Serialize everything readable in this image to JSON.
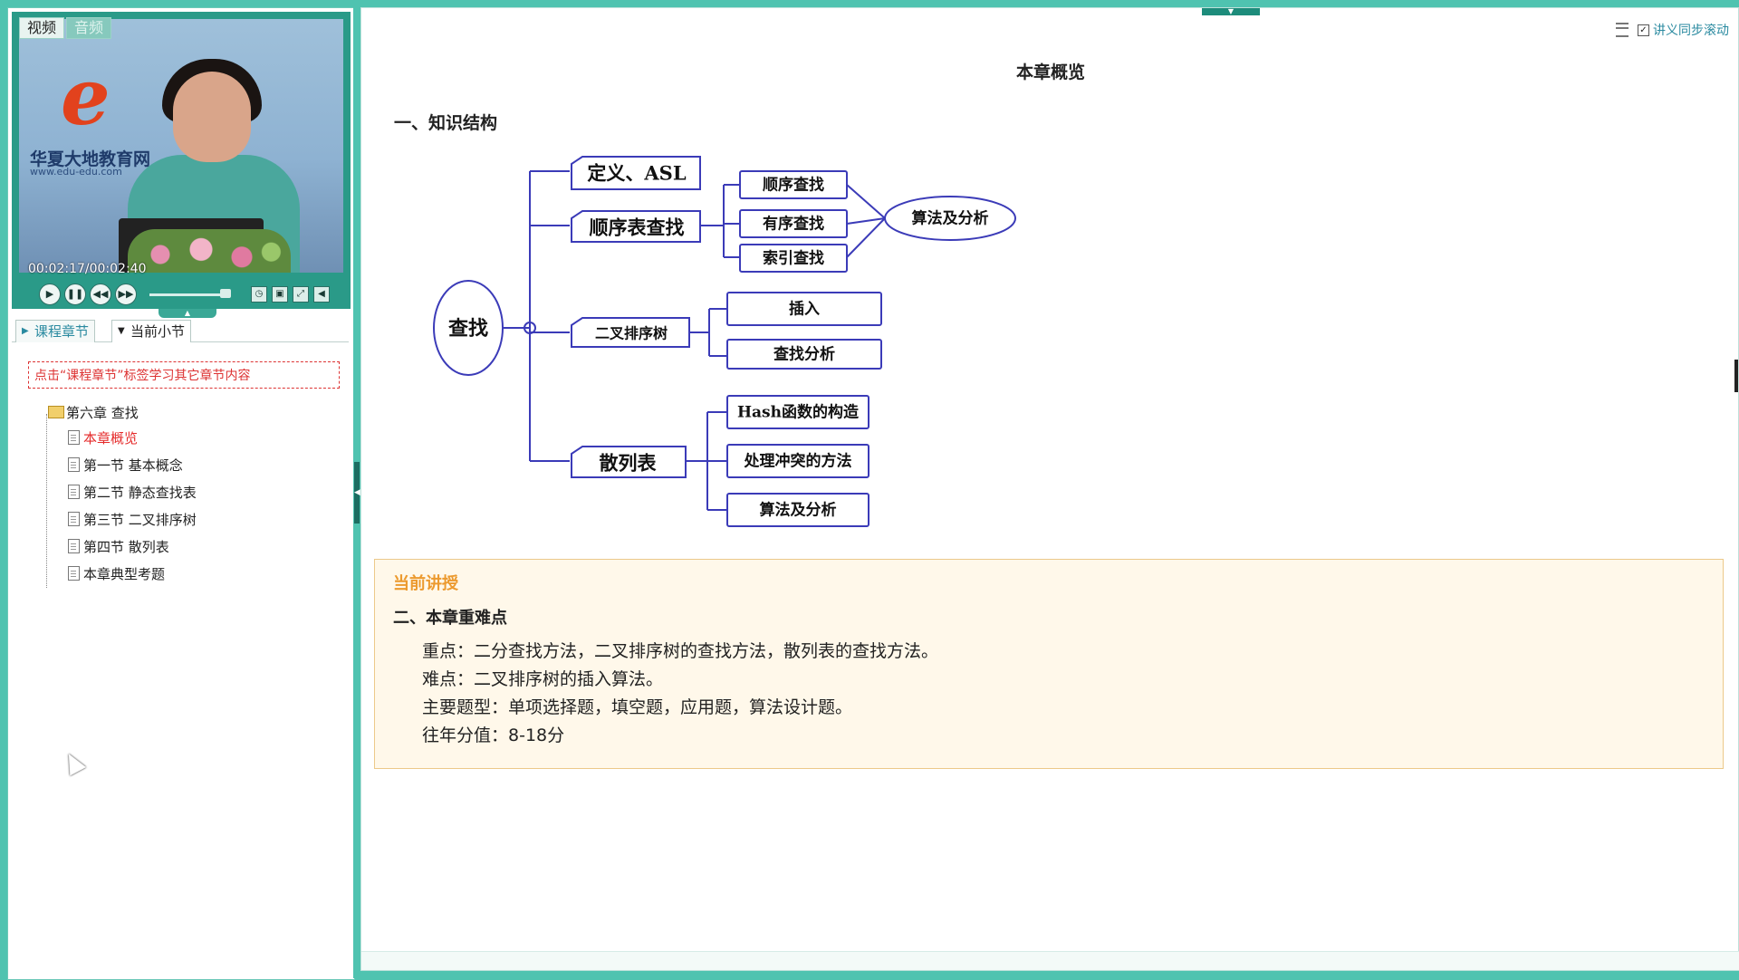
{
  "media_tabs": {
    "video": "视频",
    "audio": "音频"
  },
  "player": {
    "logo_text": "华夏大地教育网",
    "logo_url": "www.edu-edu.com",
    "time": "00:02:17/00:02:40"
  },
  "nav_tabs": {
    "chapters": "课程章节",
    "current_section": "当前小节"
  },
  "hint": "点击“课程章节”标签学习其它章节内容",
  "tree": {
    "chapter": "第六章 查找",
    "items": [
      {
        "label": "本章概览",
        "active": true
      },
      {
        "label": "第一节 基本概念",
        "active": false
      },
      {
        "label": "第二节 静态查找表",
        "active": false
      },
      {
        "label": "第三节 二叉排序树",
        "active": false
      },
      {
        "label": "第四节 散列表",
        "active": false
      },
      {
        "label": "本章典型考题",
        "active": false
      }
    ]
  },
  "toolbar": {
    "sync_label": "讲义同步滚动",
    "sync_checked": true
  },
  "content": {
    "title": "本章概览",
    "section1": "一、知识结构",
    "mindmap": {
      "root": "查找",
      "def": "定义、ASL",
      "seq_table": "顺序表查找",
      "seq_children": [
        "顺序查找",
        "有序查找",
        "索引查找"
      ],
      "algo": "算法及分析",
      "bst": "二叉排序树",
      "bst_children": [
        "插入",
        "查找分析"
      ],
      "hash": "散列表",
      "hash_children": [
        "Hash函数的构造",
        "处理冲突的方法",
        "算法及分析"
      ]
    },
    "current_label": "当前讲授",
    "section2": "二、本章重难点",
    "lines": [
      "重点：二分查找方法，二叉排序树的查找方法，散列表的查找方法。",
      "难点：二叉排序树的插入算法。",
      "主要题型：单项选择题，填空题，应用题，算法设计题。",
      "往年分值：8-18分"
    ]
  },
  "colors": {
    "accent": "#4fc3b0",
    "node_border": "#3b3bb8",
    "active_item": "#e52b2b",
    "current_label": "#ec9a2f",
    "current_bg": "#fff8ea"
  }
}
